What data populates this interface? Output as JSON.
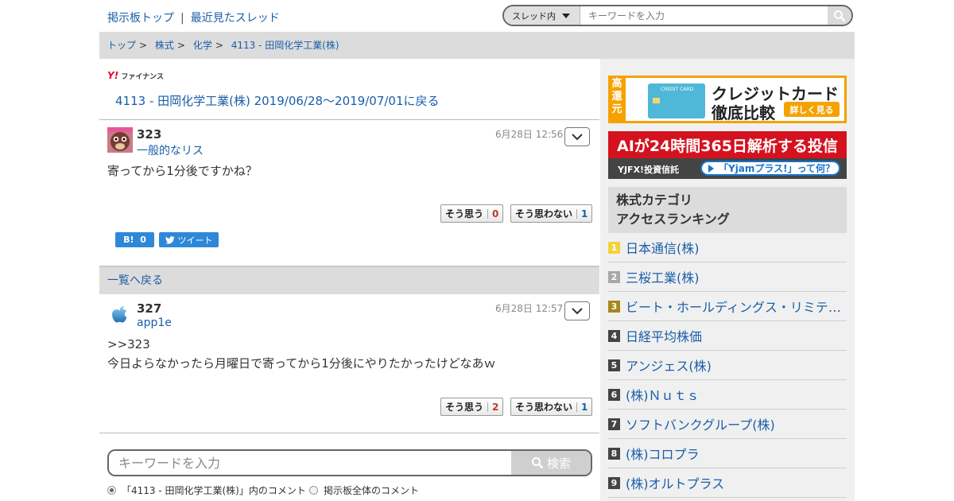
{
  "header": {
    "links": [
      "掲示板トップ",
      "最近見たスレッド"
    ],
    "separator": "|",
    "search": {
      "scope": "スレッド内",
      "placeholder": "キーワードを入力"
    }
  },
  "breadcrumb": [
    "トップ",
    "株式",
    "化学",
    "4113 - 田岡化学工業(株)"
  ],
  "thread": {
    "logo_text": "ファイナンス",
    "back_title": "4113 - 田岡化学工業(株) 2019/06/28〜2019/07/01に戻る"
  },
  "posts": [
    {
      "number": "323",
      "user": "一般的なリス",
      "date": "6月28日 12:56",
      "body": [
        "寄ってから1分後ですかね？"
      ],
      "agree_label": "そう思う",
      "agree_count": "0",
      "disagree_label": "そう思わない",
      "disagree_count": "1"
    },
    {
      "number": "327",
      "user": "app1e",
      "date": "6月28日 12:57",
      "body": [
        ">>323",
        "今日よらなかったら月曜日で寄ってから1分後にやりたかったけどなあｗ"
      ],
      "agree_label": "そう思う",
      "agree_count": "2",
      "disagree_label": "そう思わない",
      "disagree_count": "1"
    }
  ],
  "share": {
    "hatena_label": "B!",
    "hatena_count": "0",
    "tweet_label": "ツイート"
  },
  "back_to_list": "一覧へ戻る",
  "bottom_search": {
    "placeholder": "キーワードを入力",
    "button": "検索",
    "options": [
      "「4113 - 田岡化学工業(株)」内のコメント",
      "掲示板全体のコメント"
    ]
  },
  "ads": {
    "credit": {
      "vertical": [
        "高",
        "還",
        "元"
      ],
      "card_text": "CREDIT CARD",
      "line1": "クレジットカード",
      "line2": "徹底比較",
      "button": "詳しく見る"
    },
    "fund": {
      "headline": "AIが24時間365日解析する投信",
      "brand": "YJFX!投資信託",
      "pill": "「Yjamプラス!」って何？"
    }
  },
  "ranking": {
    "title_line1": "株式カテゴリ",
    "title_line2": "アクセスランキング",
    "items": [
      {
        "rank": "1",
        "name": "日本通信(株)",
        "color": "#f2d23c"
      },
      {
        "rank": "2",
        "name": "三桜工業(株)",
        "color": "#a8a8a8"
      },
      {
        "rank": "3",
        "name": "ビート・ホールディングス・リミテッド",
        "color": "#a8861a"
      },
      {
        "rank": "4",
        "name": "日経平均株価",
        "color": "#444444"
      },
      {
        "rank": "5",
        "name": "アンジェス(株)",
        "color": "#444444"
      },
      {
        "rank": "6",
        "name": "(株)Ｎｕｔｓ",
        "color": "#444444"
      },
      {
        "rank": "7",
        "name": "ソフトバンクグループ(株)",
        "color": "#444444"
      },
      {
        "rank": "8",
        "name": "(株)コロプラ",
        "color": "#444444"
      },
      {
        "rank": "9",
        "name": "(株)オルトプラス",
        "color": "#444444"
      }
    ]
  },
  "colors": {
    "link": "#1a5ea8",
    "agree": "#c0392b",
    "disagree": "#1a5ea8",
    "share": "#2e88d8"
  }
}
